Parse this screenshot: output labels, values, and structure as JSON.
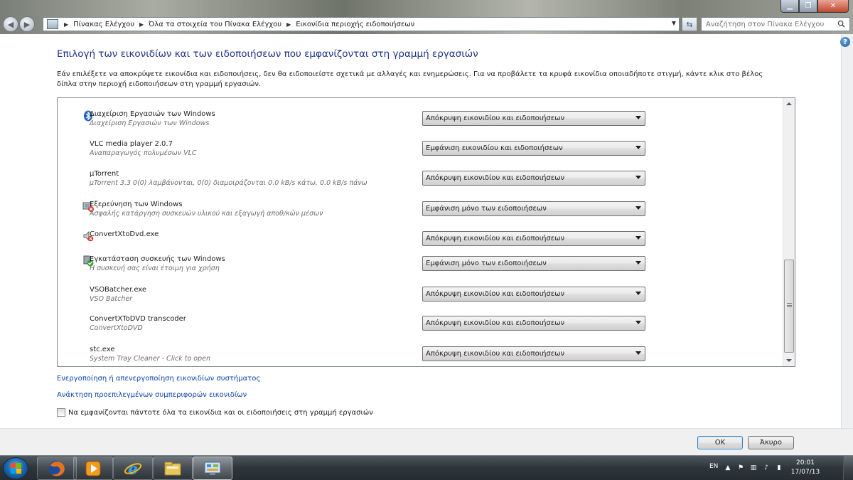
{
  "window": {
    "min_label": "▁",
    "max_label": "❐",
    "close_label": "✕"
  },
  "nav": {
    "back_icon": "arrow-left-icon",
    "forward_icon": "arrow-right-icon"
  },
  "breadcrumb": {
    "items": [
      "Πίνακας Ελέγχου",
      "Όλα τα στοιχεία του Πίνακα Ελέγχου",
      "Εικονίδια περιοχής ειδοποιήσεων"
    ]
  },
  "search": {
    "placeholder": "Αναζήτηση στον Πίνακα Ελέγχου"
  },
  "main": {
    "title": "Επιλογή των εικονιδίων και των ειδοποιήσεων που εμφανίζονται στη γραμμή εργασιών",
    "description": "Εάν επιλέξετε να αποκρύψετε εικονίδια και ειδοποιήσεις, δεν θα ειδοποιείστε σχετικά με αλλαγές και ενημερώσεις. Για να προβάλετε τα κρυφά εικονίδια οποιαδήποτε στιγμή, κάντε κλικ στο βέλος δίπλα στην περιοχή ειδοποιήσεων στη γραμμή εργασιών."
  },
  "rows": [
    {
      "name": "Διαχείριση Εργασιών των Windows",
      "desc": "Διαχείριση Εργασιών των Windows",
      "value": "Απόκρυψη εικονιδίου και ειδοποιήσεων",
      "icon": "bluetooth-icon"
    },
    {
      "name": "VLC media player 2.0.7",
      "desc": "Αναπαραγωγός πολυμέσων VLC",
      "value": "Εμφάνιση εικονιδίου και ειδοποιήσεων",
      "icon": ""
    },
    {
      "name": "µTorrent",
      "desc": "µTorrent 3.3  0(0) λαμβάνονται, 0(0) διαμοιράζονται  0.0 kB/s κάτω, 0.0 kB/s πάνω",
      "value": "Απόκρυψη εικονιδίου και ειδοποιήσεων",
      "icon": ""
    },
    {
      "name": "Εξερεύνηση των Windows",
      "desc": "Ασφαλής κατάργηση συσκευών υλικού και εξαγωγή αποθ/κών μέσων",
      "value": "Εμφάνιση μόνο των ειδοποιήσεων",
      "icon": "usb-eject-icon"
    },
    {
      "name": "ConvertXtoDvd.exe",
      "desc": "",
      "value": "Απόκρυψη εικονιδίου και ειδοποιήσεων",
      "icon": "muted-speaker-icon"
    },
    {
      "name": "Εγκατάσταση συσκευής των Windows",
      "desc": "Η συσκευή σας είναι έτοιμη για χρήση",
      "value": "Εμφάνιση μόνο των ειδοποιήσεων",
      "icon": "device-ready-icon"
    },
    {
      "name": "VSOBatcher.exe",
      "desc": "VSO Batcher",
      "value": "Απόκρυψη εικονιδίου και ειδοποιήσεων",
      "icon": ""
    },
    {
      "name": "ConvertXToDVD transcoder",
      "desc": "ConvertXtoDVD",
      "value": "Απόκρυψη εικονιδίου και ειδοποιήσεων",
      "icon": ""
    },
    {
      "name": "stc.exe",
      "desc": "System Tray Cleaner - Click to open",
      "value": "Απόκρυψη εικονιδίου και ειδοποιήσεων",
      "icon": ""
    }
  ],
  "links": {
    "system_icons": "Ενεργοποίηση ή απενεργοποίηση εικονιδίων συστήματος",
    "restore_defaults": "Ανάκτηση προεπιλεγμένων συμπεριφορών εικονιδίων"
  },
  "always_show": {
    "label": "Να εμφανίζονται πάντοτε όλα τα εικονίδια και οι ειδοποιήσεις στη γραμμή εργασιών",
    "checked": false
  },
  "buttons": {
    "ok": "OK",
    "cancel": "Άκυρο"
  },
  "taskbar": {
    "apps": [
      "firefox-icon",
      "media-player-icon",
      "internet-explorer-icon",
      "file-explorer-icon",
      "control-panel-icon"
    ],
    "lang": "EN",
    "time": "20:01",
    "date": "17/07/13"
  },
  "colors": {
    "title_blue": "#1e3287",
    "link_blue": "#0b44a8"
  }
}
